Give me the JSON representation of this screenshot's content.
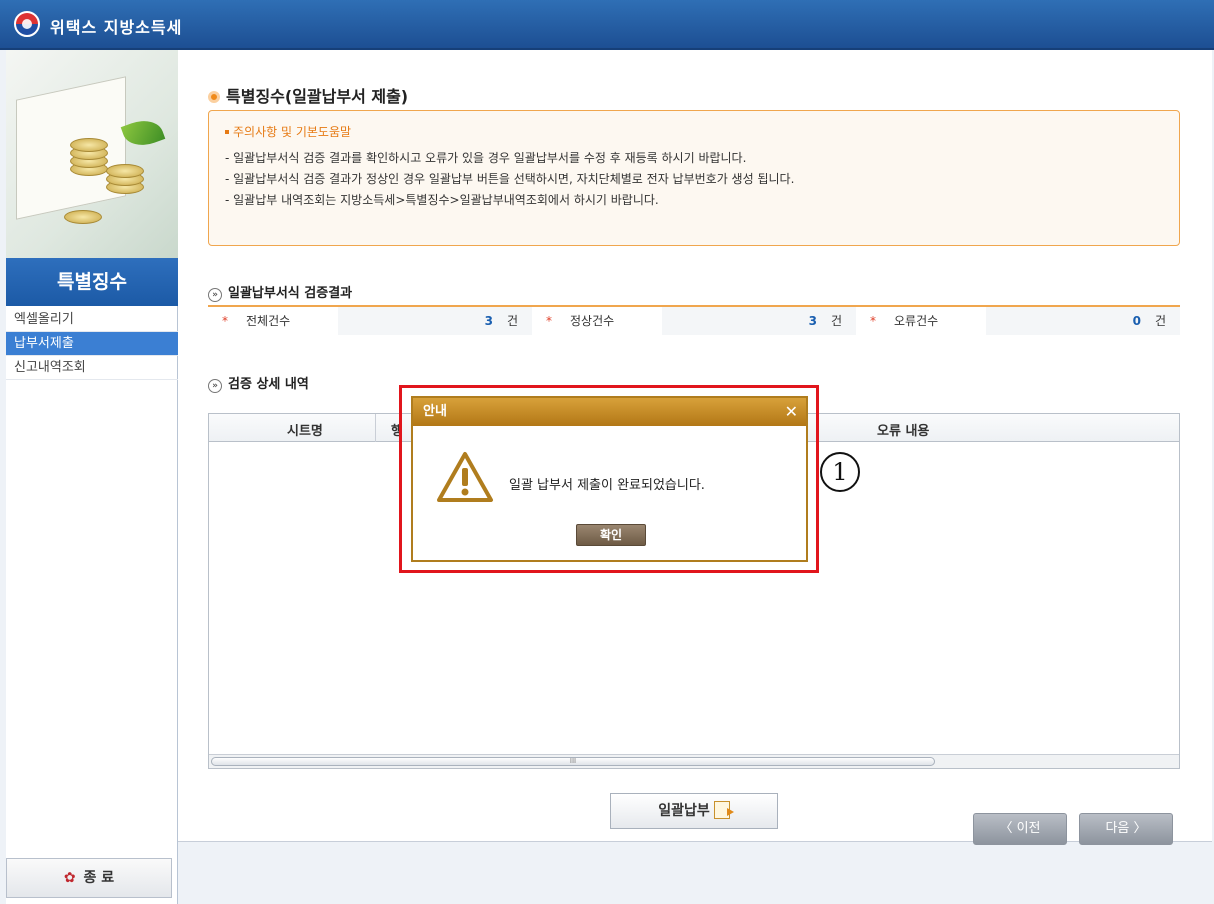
{
  "app": {
    "title": "위택스 지방소득세"
  },
  "sidebar": {
    "section_title": "특별징수",
    "items": [
      {
        "label": "엑셀올리기",
        "active": false
      },
      {
        "label": "납부서제출",
        "active": true
      },
      {
        "label": "신고내역조회",
        "active": false
      }
    ],
    "exit_label": "종 료"
  },
  "main": {
    "page_title": "특별징수(일괄납부서 제출)",
    "notice": {
      "title": "주의사항 및 기본도움말",
      "lines": [
        "- 일괄납부서식 검증 결과를 확인하시고 오류가 있을 경우  일괄납부서를 수정 후 재등록 하시기 바랍니다.",
        "- 일괄납부서식 검증 결과가 정상인 경우 일괄납부 버튼을 선택하시면, 자치단체별로 전자 납부번호가 생성 됩니다.",
        "- 일괄납부 내역조회는 지방소득세>특별징수>일괄납부내역조회에서 하시기 바랍니다."
      ]
    },
    "summary_title": "일괄납부서식 검증결과",
    "summary": [
      {
        "label": "전체건수",
        "value": "3",
        "unit": "건"
      },
      {
        "label": "정상건수",
        "value": "3",
        "unit": "건"
      },
      {
        "label": "오류건수",
        "value": "0",
        "unit": "건"
      }
    ],
    "detail_title": "검증 상세 내역",
    "grid_headers": [
      "시트명",
      "행",
      "오류 내용"
    ],
    "scroll_glyph": "III",
    "bulk_button": "일괄납부"
  },
  "nav": {
    "prev": "〈 이전",
    "next": "다음 〉"
  },
  "dialog": {
    "title": "안내",
    "close": "✕",
    "message": "일괄 납부서 제출이 완료되었습니다.",
    "ok": "확인"
  },
  "annotation": {
    "marker": "1"
  },
  "colors": {
    "accent_orange": "#f0a64e",
    "brand_blue": "#1d4f93",
    "highlight_red": "#e1151c",
    "dialog_gold": "#b27716"
  }
}
